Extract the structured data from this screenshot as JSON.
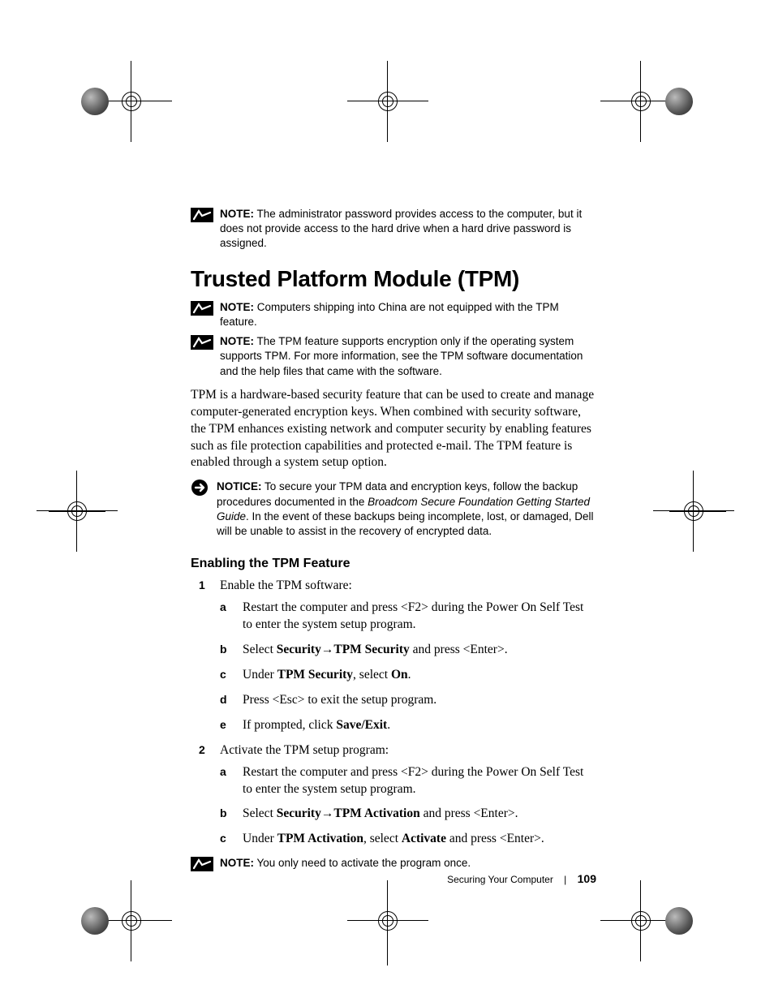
{
  "notes": {
    "top": {
      "label": "NOTE:",
      "text": " The administrator password provides access to the computer, but it does not provide access to the hard drive when a hard drive password is assigned."
    },
    "china": {
      "label": "NOTE:",
      "text": " Computers shipping into China are not equipped with the TPM feature."
    },
    "os": {
      "label": "NOTE:",
      "text": " The TPM feature supports encryption only if the operating system supports TPM. For more information, see the TPM software documentation and the help files that came with the software."
    },
    "notice": {
      "label": "NOTICE:",
      "pre": " To secure your TPM data and encryption keys, follow the backup procedures documented in the ",
      "italic": "Broadcom Secure Foundation Getting Started Guide",
      "post": ". In the event of these backups being incomplete, lost, or damaged, Dell will be unable to assist in the recovery of encrypted data."
    },
    "once": {
      "label": "NOTE:",
      "text": " You only need to activate the program once."
    }
  },
  "heading": "Trusted Platform Module (TPM)",
  "body": "TPM is a hardware-based security feature that can be used to create and manage computer-generated encryption keys. When combined with security software, the TPM enhances existing network and computer security by enabling features such as file protection capabilities and protected e-mail. The TPM feature is enabled through a system setup option.",
  "subheading": "Enabling the TPM Feature",
  "steps": {
    "s1": "Enable the TPM software:",
    "s1a": "Restart the computer and press <F2> during the Power On Self Test to enter the system setup program.",
    "s1b_pre": "Select ",
    "s1b_b1": "Security",
    "s1b_arrow": "→",
    "s1b_b2": "TPM Security",
    "s1b_post": " and press <Enter>.",
    "s1c_pre": "Under ",
    "s1c_b1": "TPM Security",
    "s1c_mid": ", select ",
    "s1c_b2": "On",
    "s1c_post": ".",
    "s1d": "Press <Esc> to exit the setup program.",
    "s1e_pre": "If prompted, click ",
    "s1e_b": "Save/Exit",
    "s1e_post": ".",
    "s2": "Activate the TPM setup program:",
    "s2a": "Restart the computer and press <F2> during the Power On Self Test to enter the system setup program.",
    "s2b_pre": "Select ",
    "s2b_b1": "Security",
    "s2b_arrow": "→",
    "s2b_b2": "TPM Activation",
    "s2b_post": " and press <Enter>.",
    "s2c_pre": "Under ",
    "s2c_b1": "TPM Activation",
    "s2c_mid": ", select ",
    "s2c_b2": "Activate",
    "s2c_post": " and press <Enter>."
  },
  "footer": {
    "section": "Securing Your Computer",
    "page": "109"
  }
}
